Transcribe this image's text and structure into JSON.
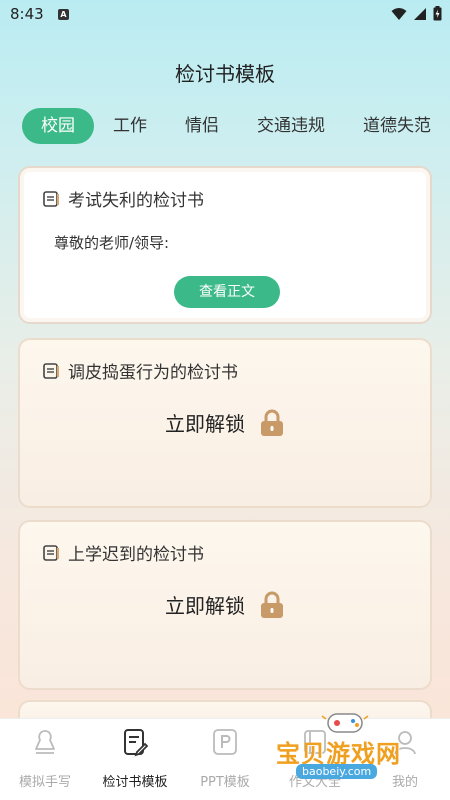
{
  "status": {
    "time": "8:43",
    "a_badge": "A"
  },
  "page": {
    "title": "检讨书模板"
  },
  "tabs": [
    {
      "label": "校园",
      "active": true
    },
    {
      "label": "工作",
      "active": false
    },
    {
      "label": "情侣",
      "active": false
    },
    {
      "label": "交通违规",
      "active": false
    },
    {
      "label": "道德失范",
      "active": false
    }
  ],
  "cards": [
    {
      "title": "考试失利的检讨书",
      "body": "尊敬的老师/领导:",
      "button": "查看正文",
      "locked": false
    },
    {
      "title": "调皮捣蛋行为的检讨书",
      "unlock_label": "立即解锁",
      "locked": true
    },
    {
      "title": "上学迟到的检讨书",
      "unlock_label": "立即解锁",
      "locked": true
    }
  ],
  "bottom_nav": [
    {
      "label": "模拟手写",
      "icon": "hand-icon",
      "active": false
    },
    {
      "label": "检讨书模板",
      "icon": "document-edit-icon",
      "active": true
    },
    {
      "label": "PPT模板",
      "icon": "ppt-icon",
      "active": false
    },
    {
      "label": "作文大全",
      "icon": "book-icon",
      "active": false
    },
    {
      "label": "我的",
      "icon": "user-icon",
      "active": false
    }
  ],
  "watermark": {
    "title": "宝贝游戏网",
    "url": "baobeiy.com"
  },
  "colors": {
    "accent": "#3cb989",
    "lock": "#c89a68",
    "watermark": "#f0a020"
  }
}
